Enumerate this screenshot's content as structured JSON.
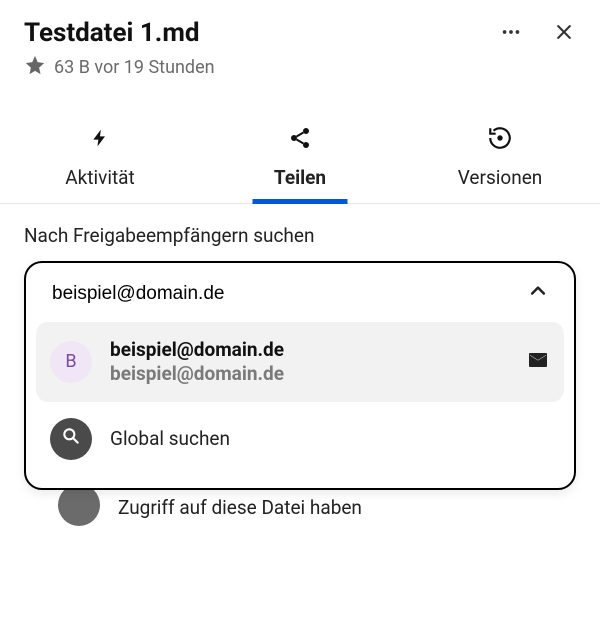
{
  "header": {
    "title": "Testdatei 1.md",
    "meta": "63 B vor 19 Stunden"
  },
  "tabs": {
    "activity": "Aktivität",
    "share": "Teilen",
    "versions": "Versionen"
  },
  "share": {
    "search_label": "Nach Freigabeempfängern suchen",
    "input_value": "beispiel@domain.de",
    "suggestion": {
      "initial": "B",
      "primary": "beispiel@domain.de",
      "secondary": "beispiel@domain.de"
    },
    "global_search": "Global suchen",
    "link_hint": "Zugriff auf diese Datei haben"
  }
}
